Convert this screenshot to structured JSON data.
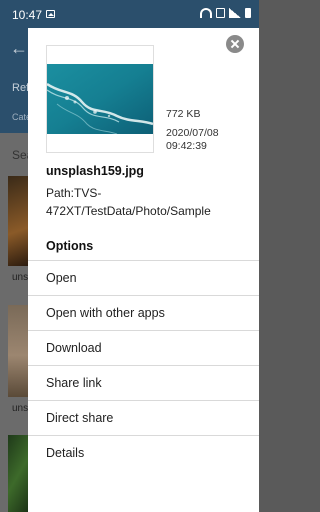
{
  "status_bar": {
    "time": "10:47"
  },
  "background": {
    "title": "Refi",
    "subtitle": "Cate",
    "search": "Sea",
    "item1_label": "uns",
    "item2_label": "uns"
  },
  "sheet": {
    "file_size": "772 KB",
    "date": "2020/07/08",
    "time": "09:42:39",
    "file_name": "unsplash159.jpg",
    "path": "Path:TVS-472XT/TestData/Photo/Sample",
    "options_heading": "Options",
    "options": [
      {
        "label": "Open"
      },
      {
        "label": "Open with other apps"
      },
      {
        "label": "Download"
      },
      {
        "label": "Share link"
      },
      {
        "label": "Direct share"
      },
      {
        "label": "Details"
      }
    ]
  },
  "icons": {
    "close": "close-icon",
    "back": "arrow-left-icon"
  }
}
